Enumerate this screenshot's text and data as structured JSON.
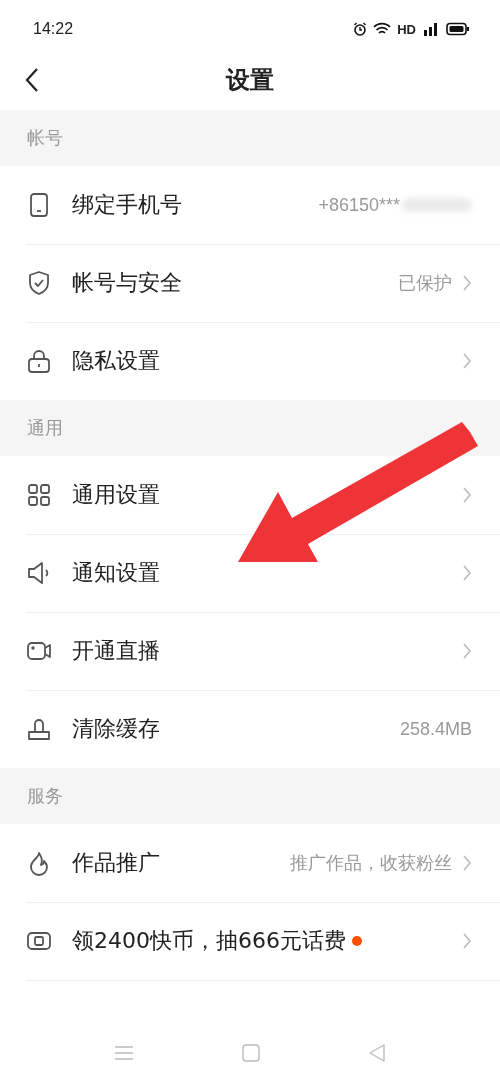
{
  "status_bar": {
    "time": "14:22",
    "network": "HD"
  },
  "header": {
    "title": "设置"
  },
  "sections": [
    {
      "title": "帐号",
      "items": [
        {
          "kind": "phone",
          "label": "绑定手机号",
          "value": "+86150***",
          "redacted": true,
          "chevron": false
        },
        {
          "kind": "shield",
          "label": "帐号与安全",
          "value": "已保护",
          "chevron": true
        },
        {
          "kind": "lock",
          "label": "隐私设置",
          "chevron": true
        }
      ]
    },
    {
      "title": "通用",
      "items": [
        {
          "kind": "grid",
          "label": "通用设置",
          "chevron": true
        },
        {
          "kind": "speaker",
          "label": "通知设置",
          "chevron": true
        },
        {
          "kind": "camera",
          "label": "开通直播",
          "chevron": true
        },
        {
          "kind": "brush",
          "label": "清除缓存",
          "value": "258.4MB",
          "chevron": false
        }
      ]
    },
    {
      "title": "服务",
      "items": [
        {
          "kind": "flame",
          "label": "作品推广",
          "value": "推广作品，收获粉丝",
          "chevron": true
        },
        {
          "kind": "coin",
          "label": "领2400快币，抽666元话费",
          "color": "#ff5000",
          "chevron": true
        }
      ]
    }
  ]
}
